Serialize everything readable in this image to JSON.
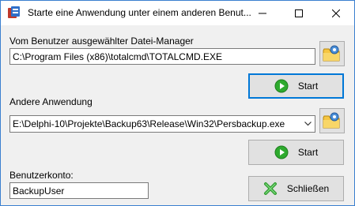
{
  "window": {
    "title": "Starte eine Anwendung unter einem anderen Benut..."
  },
  "filemanager": {
    "label": "Vom Benutzer ausgewählter Datei-Manager",
    "path": "C:\\Program Files (x86)\\totalcmd\\TOTALCMD.EXE",
    "start_label": "Start"
  },
  "other_app": {
    "label": "Andere Anwendung",
    "path": "E:\\Delphi-10\\Projekte\\Backup63\\Release\\Win32\\Persbackup.exe",
    "start_label": "Start"
  },
  "account": {
    "label": "Benutzerkonto:",
    "value": "BackupUser"
  },
  "close_button": {
    "label": "Schließen"
  },
  "colors": {
    "start_icon": "#2eaa2e",
    "close_icon": "#2e9c2e",
    "default_border": "#0078d7"
  },
  "icons": {
    "settings": "folder-gear-icon",
    "start": "play-icon",
    "close": "green-x-icon"
  }
}
